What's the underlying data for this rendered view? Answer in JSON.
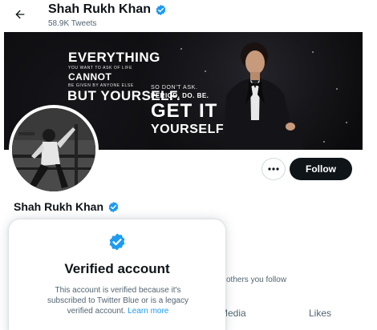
{
  "header": {
    "name": "Shah Rukh Khan",
    "tweets": "58.9K Tweets"
  },
  "banner": {
    "line1": "EVERYTHING",
    "line1_small": "YOU WANT TO ASK OF LIFE",
    "line2": "CANNOT",
    "line2_small": "BE GIVEN BY ANYONE ELSE",
    "line3": "BUT YOURSELF.",
    "right_small": "SO DON'T ASK.",
    "right_line2": "PERIOD. DO. BE.",
    "right_big": "GET IT",
    "right_line4": "YOURSELF"
  },
  "actions": {
    "more_icon": "ellipsis-icon",
    "follow_label": "Follow"
  },
  "profile": {
    "name": "Shah Rukh Khan",
    "followed_text": "others you follow"
  },
  "tabs": [
    {
      "label": "Media"
    },
    {
      "label": "Likes"
    }
  ],
  "popover": {
    "title": "Verified account",
    "body": "This account is verified because it's subscribed to Twitter Blue or is a legacy verified account.",
    "link": "Learn more"
  },
  "colors": {
    "accent": "#1d9bf0",
    "text": "#0f1419",
    "muted": "#536471",
    "follow_bg": "#0f1419"
  }
}
